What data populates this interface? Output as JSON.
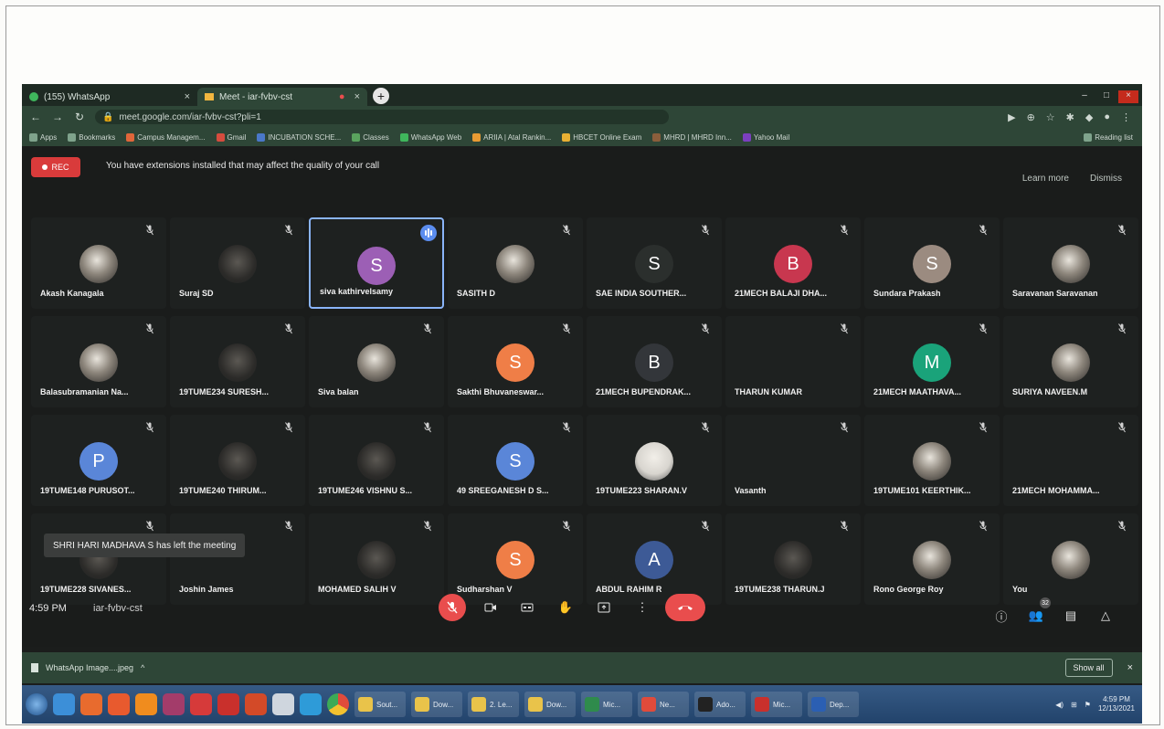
{
  "browser": {
    "tabs": [
      {
        "title": "(155) WhatsApp",
        "active": false
      },
      {
        "title": "Meet - iar-fvbv-cst",
        "active": true
      }
    ],
    "url": "meet.google.com/iar-fvbv-cst?pli=1",
    "bookmarks": [
      "Apps",
      "Bookmarks",
      "Campus Managem...",
      "Gmail",
      "INCUBATION SCHE...",
      "Classes",
      "WhatsApp Web",
      "ARIIA | Atal Rankin...",
      "HBCET Online Exam",
      "MHRD | MHRD Inn...",
      "Yahoo Mail"
    ],
    "reading_list": "Reading list"
  },
  "meet": {
    "rec_label": "REC",
    "notice": "You have extensions installed that may affect the quality of your call",
    "learn_more": "Learn more",
    "dismiss": "Dismiss",
    "participants": [
      {
        "name": "Akash Kanagala",
        "avatar": "photo"
      },
      {
        "name": "Suraj SD",
        "avatar": "dim"
      },
      {
        "name": "siva kathirvelsamy",
        "avatar": "S",
        "color": "#9c5fb5",
        "speaking": true
      },
      {
        "name": "SASITH D",
        "avatar": "photo"
      },
      {
        "name": "SAE INDIA SOUTHER...",
        "avatar": "S",
        "color": "#2b2f2d"
      },
      {
        "name": "21MECH BALAJI DHA...",
        "avatar": "B",
        "color": "#c8374f"
      },
      {
        "name": "Sundara Prakash",
        "avatar": "S",
        "color": "#9b8b80"
      },
      {
        "name": "Saravanan Saravanan",
        "avatar": "photo"
      },
      {
        "name": "Balasubramanian Na...",
        "avatar": "photo"
      },
      {
        "name": "19TUME234 SURESH...",
        "avatar": "dim"
      },
      {
        "name": "Siva balan",
        "avatar": "photo"
      },
      {
        "name": "Sakthi Bhuvaneswar...",
        "avatar": "S",
        "color": "#ef7e47"
      },
      {
        "name": "21MECH BUPENDRAK...",
        "avatar": "B",
        "color": "#33363a"
      },
      {
        "name": "THARUN KUMAR",
        "avatar": "none"
      },
      {
        "name": "21MECH MAATHAVA...",
        "avatar": "M",
        "color": "#1aa37a"
      },
      {
        "name": "SURIYA NAVEEN.M",
        "avatar": "photo"
      },
      {
        "name": "19TUME148 PURUSOT...",
        "avatar": "P",
        "color": "#5a86d8"
      },
      {
        "name": "19TUME240 THIRUM...",
        "avatar": "dim"
      },
      {
        "name": "19TUME246 VISHNU S...",
        "avatar": "dim"
      },
      {
        "name": "49 SREEGANESH D S...",
        "avatar": "S",
        "color": "#5a86d8"
      },
      {
        "name": "19TUME223 SHARAN.V",
        "avatar": "video"
      },
      {
        "name": "Vasanth",
        "avatar": "none"
      },
      {
        "name": "19TUME101 KEERTHIK...",
        "avatar": "photo"
      },
      {
        "name": "21MECH MOHAMMA...",
        "avatar": "none"
      },
      {
        "name": "19TUME228 SIVANES...",
        "avatar": "dim"
      },
      {
        "name": "Joshin James",
        "avatar": "none"
      },
      {
        "name": "MOHAMED SALIH V",
        "avatar": "dim"
      },
      {
        "name": "Sudharshan V",
        "avatar": "S",
        "color": "#ef7e47"
      },
      {
        "name": "ABDUL RAHIM R",
        "avatar": "A",
        "color": "#3d5a96"
      },
      {
        "name": "19TUME238 THARUN.J",
        "avatar": "dim"
      },
      {
        "name": "Rono George Roy",
        "avatar": "photo"
      },
      {
        "name": "You",
        "avatar": "photo"
      }
    ],
    "toast": "SHRI HARI MADHAVA S has left the meeting",
    "time": "4:59 PM",
    "meeting_code": "iar-fvbv-cst",
    "people_count": "32"
  },
  "downloads": {
    "file": "WhatsApp Image....jpeg",
    "show_all": "Show all"
  },
  "taskbar": {
    "tasks": [
      "Sout...",
      "Dow...",
      "2. Le...",
      "Dow...",
      "Mic...",
      "Ne...",
      "Ado...",
      "Mic...",
      "Dep..."
    ],
    "clock_time": "4:59 PM",
    "clock_date": "12/13/2021"
  }
}
